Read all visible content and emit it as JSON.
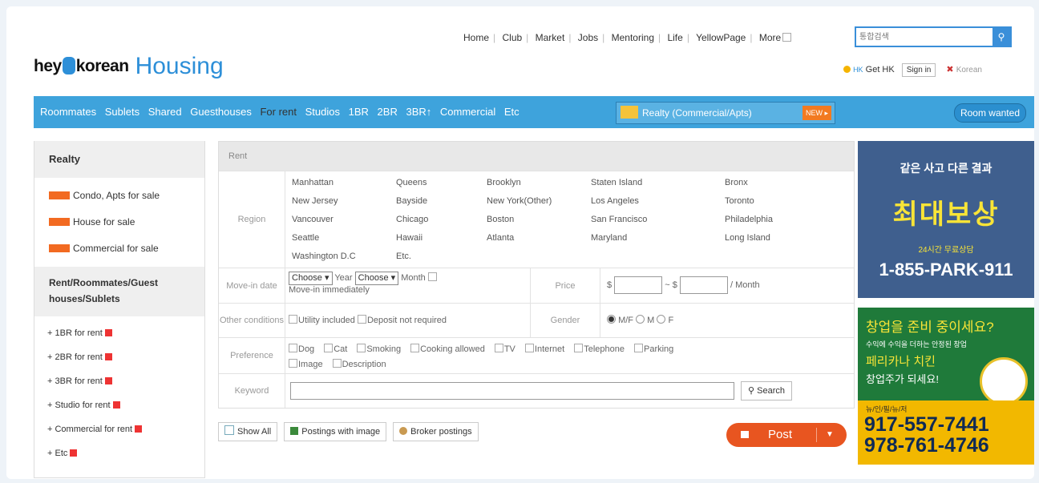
{
  "header": {
    "logo_hey": "hey",
    "logo_korean": "korean",
    "logo_section": "Housing",
    "nav": [
      "Home",
      "Club",
      "Market",
      "Jobs",
      "Mentoring",
      "Life",
      "YellowPage",
      "More"
    ],
    "search_placeholder": "통합검색",
    "get_hk": "Get HK",
    "hk_label": "HK",
    "sign_in": "Sign in",
    "language": "Korean"
  },
  "menu": {
    "items": [
      "Roommates",
      "Sublets",
      "Shared",
      "Guesthouses",
      "For rent",
      "Studios",
      "1BR",
      "2BR",
      "3BR↑",
      "Commercial",
      "Etc"
    ],
    "active_index": 4,
    "realty_label": "Realty (Commercial/Apts)",
    "new_badge": "NEW ▸",
    "room_wanted": "Room wanted"
  },
  "sidebar": {
    "realty_heading": "Realty",
    "realty_links": [
      "Condo, Apts for sale",
      "House for sale",
      "Commercial for sale"
    ],
    "rent_heading": "Rent/Roommates/Guest houses/Sublets",
    "rent_links": [
      "1BR for rent",
      "2BR for rent",
      "3BR for rent",
      "Studio for rent",
      "Commercial for rent",
      "Etc"
    ]
  },
  "form": {
    "heading": "Rent",
    "region_label": "Region",
    "regions": [
      "Manhattan",
      "Queens",
      "Brooklyn",
      "Staten Island",
      "Bronx",
      "New Jersey",
      "Bayside",
      "New York(Other)",
      "Los Angeles",
      "Toronto",
      "Vancouver",
      "Chicago",
      "Boston",
      "San Francisco",
      "Philadelphia",
      "Seattle",
      "Hawaii",
      "Atlanta",
      "Maryland",
      "Long Island",
      "Washington D.C",
      "Etc."
    ],
    "movein_label": "Move-in date",
    "choose": "Choose ▾",
    "year": "Year",
    "month": "Month",
    "move_in_immediately": "Move-in immediately",
    "price_label": "Price",
    "dollar": "$",
    "tilde": "~ $",
    "per_month": "/ Month",
    "other_label": "Other conditions",
    "utility": "Utility included",
    "deposit": "Deposit not required",
    "gender_label": "Gender",
    "gender_options": [
      "M/F",
      "M",
      "F"
    ],
    "preference_label": "Preference",
    "preferences": [
      "Dog",
      "Cat",
      "Smoking",
      "Cooking allowed",
      "TV",
      "Internet",
      "Telephone",
      "Parking",
      "Image",
      "Description"
    ],
    "keyword_label": "Keyword",
    "search_button": "Search"
  },
  "actions": {
    "show_all": "Show All",
    "postings_with_image": "Postings with image",
    "broker_postings": "Broker postings",
    "post": "Post"
  },
  "ads": {
    "ad1_line1": "같은 사고 다른 결과",
    "ad1_line2": "최대보상",
    "ad1_line3": "24시간 무료상담",
    "ad1_phone": "1-855-PARK-911",
    "ad2_line1": "창업을 준비 중이세요?",
    "ad2_line2": "수익에 수익을 더하는 안정된 창업",
    "ad2_line3": "페리카나 치킨",
    "ad2_line4": "창업주가 되세요!",
    "ad2_regions": "뉴/인/필/뉴/저",
    "ad2_phone1": "917-557-7441",
    "ad2_phone2": "978-761-4746"
  },
  "colors": {
    "menu_blue": "#3ea3dc",
    "brand_blue": "#2d8fd8",
    "post_orange": "#e85520",
    "new_badge": "#f26a21"
  }
}
